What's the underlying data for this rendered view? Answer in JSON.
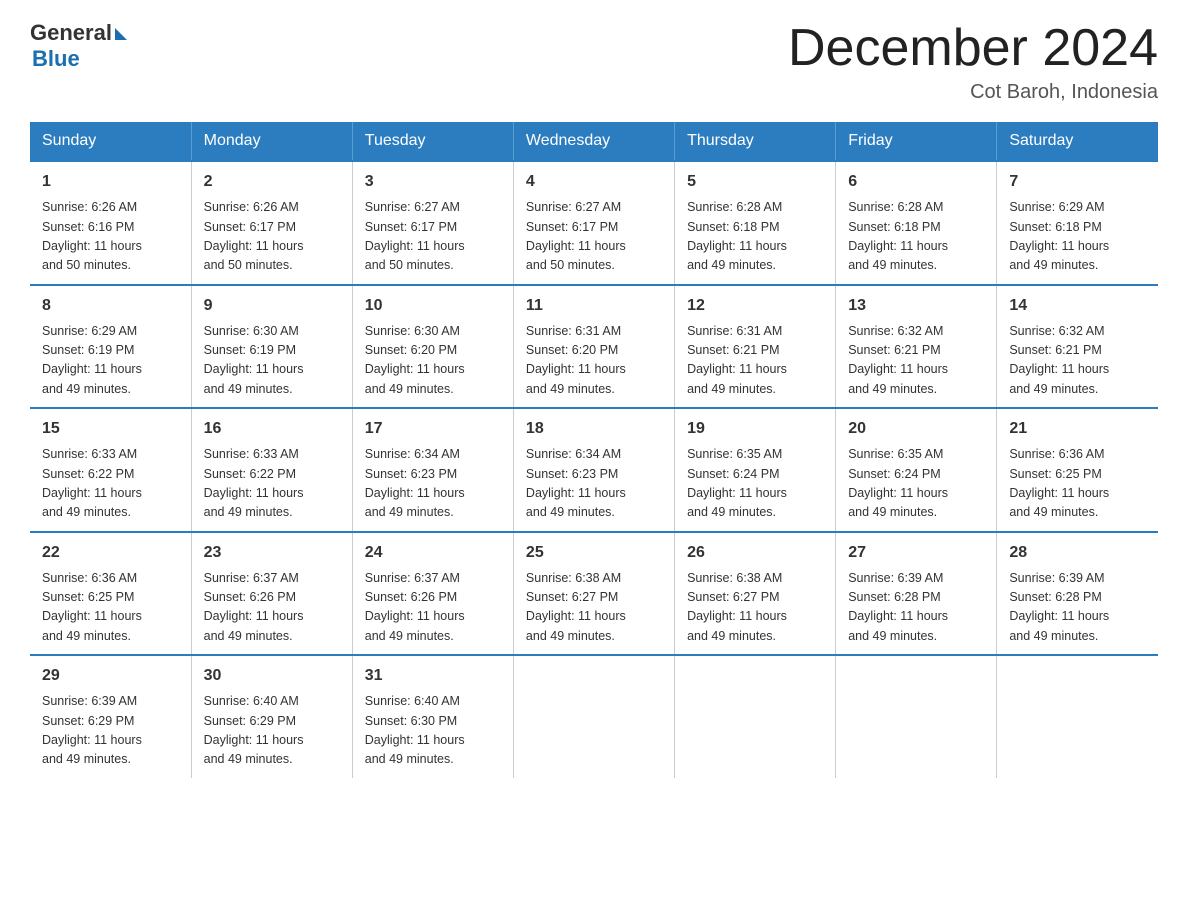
{
  "logo": {
    "general": "General",
    "blue": "Blue"
  },
  "header": {
    "month_year": "December 2024",
    "location": "Cot Baroh, Indonesia"
  },
  "weekdays": [
    "Sunday",
    "Monday",
    "Tuesday",
    "Wednesday",
    "Thursday",
    "Friday",
    "Saturday"
  ],
  "weeks": [
    [
      {
        "day": "1",
        "sunrise": "6:26 AM",
        "sunset": "6:16 PM",
        "daylight": "11 hours and 50 minutes."
      },
      {
        "day": "2",
        "sunrise": "6:26 AM",
        "sunset": "6:17 PM",
        "daylight": "11 hours and 50 minutes."
      },
      {
        "day": "3",
        "sunrise": "6:27 AM",
        "sunset": "6:17 PM",
        "daylight": "11 hours and 50 minutes."
      },
      {
        "day": "4",
        "sunrise": "6:27 AM",
        "sunset": "6:17 PM",
        "daylight": "11 hours and 50 minutes."
      },
      {
        "day": "5",
        "sunrise": "6:28 AM",
        "sunset": "6:18 PM",
        "daylight": "11 hours and 49 minutes."
      },
      {
        "day": "6",
        "sunrise": "6:28 AM",
        "sunset": "6:18 PM",
        "daylight": "11 hours and 49 minutes."
      },
      {
        "day": "7",
        "sunrise": "6:29 AM",
        "sunset": "6:18 PM",
        "daylight": "11 hours and 49 minutes."
      }
    ],
    [
      {
        "day": "8",
        "sunrise": "6:29 AM",
        "sunset": "6:19 PM",
        "daylight": "11 hours and 49 minutes."
      },
      {
        "day": "9",
        "sunrise": "6:30 AM",
        "sunset": "6:19 PM",
        "daylight": "11 hours and 49 minutes."
      },
      {
        "day": "10",
        "sunrise": "6:30 AM",
        "sunset": "6:20 PM",
        "daylight": "11 hours and 49 minutes."
      },
      {
        "day": "11",
        "sunrise": "6:31 AM",
        "sunset": "6:20 PM",
        "daylight": "11 hours and 49 minutes."
      },
      {
        "day": "12",
        "sunrise": "6:31 AM",
        "sunset": "6:21 PM",
        "daylight": "11 hours and 49 minutes."
      },
      {
        "day": "13",
        "sunrise": "6:32 AM",
        "sunset": "6:21 PM",
        "daylight": "11 hours and 49 minutes."
      },
      {
        "day": "14",
        "sunrise": "6:32 AM",
        "sunset": "6:21 PM",
        "daylight": "11 hours and 49 minutes."
      }
    ],
    [
      {
        "day": "15",
        "sunrise": "6:33 AM",
        "sunset": "6:22 PM",
        "daylight": "11 hours and 49 minutes."
      },
      {
        "day": "16",
        "sunrise": "6:33 AM",
        "sunset": "6:22 PM",
        "daylight": "11 hours and 49 minutes."
      },
      {
        "day": "17",
        "sunrise": "6:34 AM",
        "sunset": "6:23 PM",
        "daylight": "11 hours and 49 minutes."
      },
      {
        "day": "18",
        "sunrise": "6:34 AM",
        "sunset": "6:23 PM",
        "daylight": "11 hours and 49 minutes."
      },
      {
        "day": "19",
        "sunrise": "6:35 AM",
        "sunset": "6:24 PM",
        "daylight": "11 hours and 49 minutes."
      },
      {
        "day": "20",
        "sunrise": "6:35 AM",
        "sunset": "6:24 PM",
        "daylight": "11 hours and 49 minutes."
      },
      {
        "day": "21",
        "sunrise": "6:36 AM",
        "sunset": "6:25 PM",
        "daylight": "11 hours and 49 minutes."
      }
    ],
    [
      {
        "day": "22",
        "sunrise": "6:36 AM",
        "sunset": "6:25 PM",
        "daylight": "11 hours and 49 minutes."
      },
      {
        "day": "23",
        "sunrise": "6:37 AM",
        "sunset": "6:26 PM",
        "daylight": "11 hours and 49 minutes."
      },
      {
        "day": "24",
        "sunrise": "6:37 AM",
        "sunset": "6:26 PM",
        "daylight": "11 hours and 49 minutes."
      },
      {
        "day": "25",
        "sunrise": "6:38 AM",
        "sunset": "6:27 PM",
        "daylight": "11 hours and 49 minutes."
      },
      {
        "day": "26",
        "sunrise": "6:38 AM",
        "sunset": "6:27 PM",
        "daylight": "11 hours and 49 minutes."
      },
      {
        "day": "27",
        "sunrise": "6:39 AM",
        "sunset": "6:28 PM",
        "daylight": "11 hours and 49 minutes."
      },
      {
        "day": "28",
        "sunrise": "6:39 AM",
        "sunset": "6:28 PM",
        "daylight": "11 hours and 49 minutes."
      }
    ],
    [
      {
        "day": "29",
        "sunrise": "6:39 AM",
        "sunset": "6:29 PM",
        "daylight": "11 hours and 49 minutes."
      },
      {
        "day": "30",
        "sunrise": "6:40 AM",
        "sunset": "6:29 PM",
        "daylight": "11 hours and 49 minutes."
      },
      {
        "day": "31",
        "sunrise": "6:40 AM",
        "sunset": "6:30 PM",
        "daylight": "11 hours and 49 minutes."
      },
      null,
      null,
      null,
      null
    ]
  ],
  "labels": {
    "sunrise": "Sunrise:",
    "sunset": "Sunset:",
    "daylight": "Daylight:"
  }
}
